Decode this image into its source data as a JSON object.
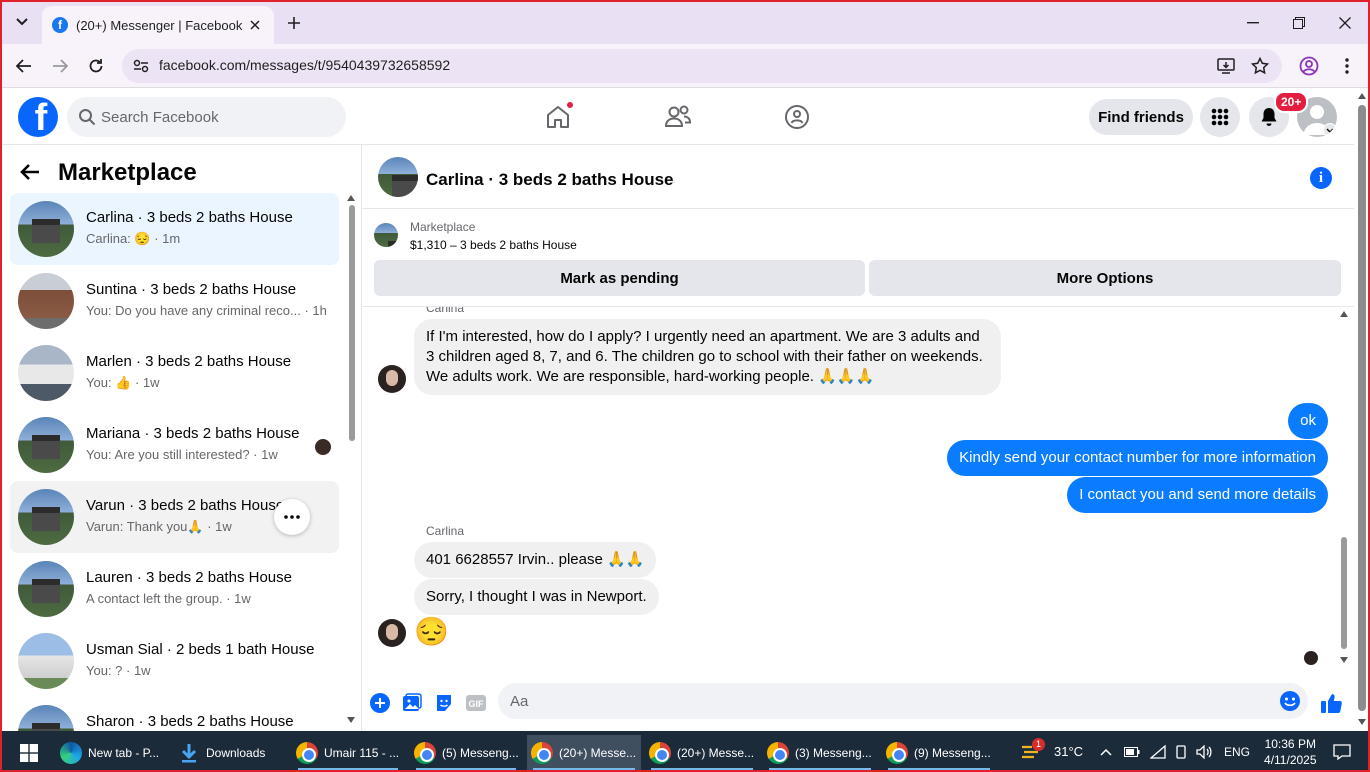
{
  "browser": {
    "tab_title": "(20+) Messenger | Facebook",
    "url": "facebook.com/messages/t/9540439732658592"
  },
  "header": {
    "search_placeholder": "Search Facebook",
    "find_friends": "Find friends",
    "notification_badge": "20+"
  },
  "sidebar": {
    "title": "Marketplace",
    "conversations": [
      {
        "name": "Carlina · 3 beds 2 baths House",
        "preview": "Carlina: 😔 · 1m"
      },
      {
        "name": "Suntina · 3 beds 2 baths House",
        "preview": "You: Do you have any criminal reco... · 1h"
      },
      {
        "name": "Marlen · 3 beds 2 baths House",
        "preview": "You: 👍 · 1w"
      },
      {
        "name": "Mariana · 3 beds 2 baths House",
        "preview": "You: Are you still interested? · 1w"
      },
      {
        "name": "Varun · 3 beds 2 baths House",
        "preview": "Varun: Thank you🙏 · 1w"
      },
      {
        "name": "Lauren · 3 beds 2 baths House",
        "preview": "A contact left the group. · 1w"
      },
      {
        "name": "Usman Sial · 2 beds 1 bath House",
        "preview": "You: ? · 1w"
      },
      {
        "name": "Sharon · 3 beds 2 baths House",
        "preview": ""
      }
    ]
  },
  "chat": {
    "title": "Carlina · 3 beds 2 baths House",
    "listing": {
      "category": "Marketplace",
      "price_title": "$1,310 – 3 beds 2 baths House",
      "btn_pending": "Mark as pending",
      "btn_more": "More Options"
    },
    "messages": [
      {
        "sender": "Carlina",
        "text": "If I'm interested, how do I apply? I urgently need an apartment. We are 3 adults and 3 children aged 8, 7, and 6. The children go to school with their father on weekends. We adults work. We are responsible, hard-working people. 🙏🙏🙏"
      },
      {
        "sender": "You",
        "text": "ok"
      },
      {
        "sender": "You",
        "text": "Kindly send your contact number for more information"
      },
      {
        "sender": "You",
        "text": "I contact you and send more details"
      },
      {
        "sender": "Carlina",
        "text": "401 6628557 Irvin.. please 🙏🙏"
      },
      {
        "sender": "Carlina",
        "text": "Sorry, I thought I was in Newport."
      },
      {
        "sender": "Carlina",
        "text": "😔"
      }
    ],
    "second_sender_label": "Carlina",
    "composer_placeholder": "Aa"
  },
  "taskbar": {
    "items": [
      {
        "label": "New tab - P..."
      },
      {
        "label": "Downloads"
      },
      {
        "label": "Umair 115 - ..."
      },
      {
        "label": "(5) Messeng..."
      },
      {
        "label": "(20+) Messe..."
      },
      {
        "label": "(20+) Messe..."
      },
      {
        "label": "(3) Messeng..."
      },
      {
        "label": "(9) Messeng..."
      }
    ],
    "weather": "31°C",
    "weather_badge": "1",
    "language": "ENG",
    "time": "10:36 PM",
    "date": "4/11/2025"
  }
}
